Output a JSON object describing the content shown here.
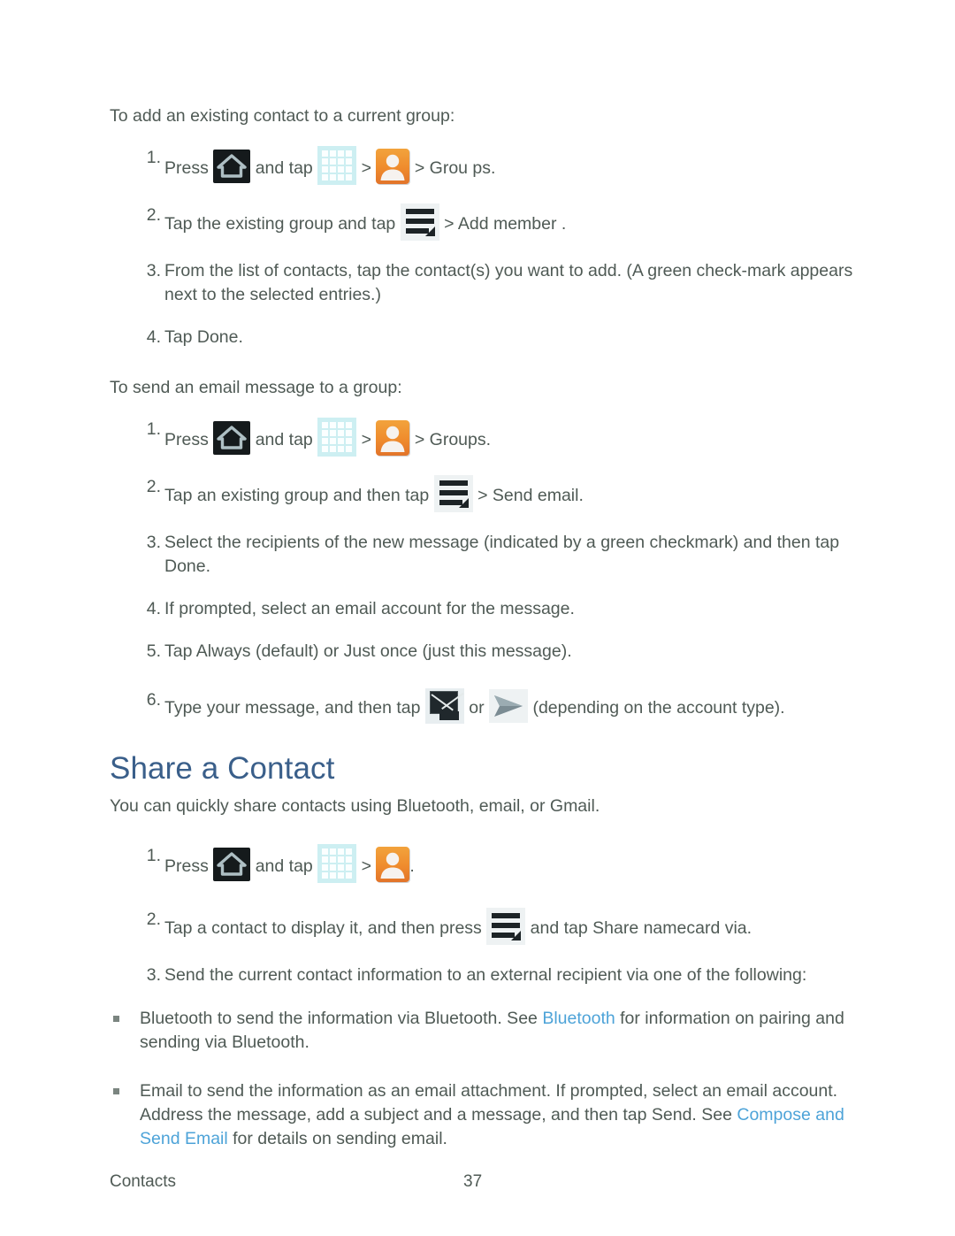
{
  "sections": [
    {
      "intro": "To add an existing contact to a current group:",
      "steps": [
        {
          "num": "1.",
          "pre": "Press",
          "mid": "and tap",
          "sep1": ">",
          "sep2": ">",
          "post": "Grou ps."
        },
        {
          "num": "2.",
          "pre": "Tap the existing group and tap",
          "sep1": ">",
          "post": "Add member ."
        },
        {
          "num": "3.",
          "text": "From the list of contacts, tap the contact(s) you want to add. (A green check-mark appears next to the selected entries.)"
        },
        {
          "num": "4.",
          "text": "Tap Done."
        }
      ]
    },
    {
      "intro": "To send an email message to a group:",
      "steps": [
        {
          "num": "1.",
          "pre": "Press",
          "mid": "and tap",
          "sep1": ">",
          "sep2": ">",
          "post": "Groups."
        },
        {
          "num": "2.",
          "pre": "Tap an existing group and then tap",
          "sep1": ">",
          "post": "Send email."
        },
        {
          "num": "3.",
          "text": "Select the recipients of the new message (indicated by a green checkmark) and then tap Done."
        },
        {
          "num": "4.",
          "text": "If prompted, select an email account for the message."
        },
        {
          "num": "5.",
          "text": "Tap Always  (default) or Just once  (just this message)."
        },
        {
          "num": "6.",
          "pre": "Type your message, and then tap",
          "mid": "or",
          "post": "(depending on the account type)."
        }
      ]
    }
  ],
  "share_section": {
    "title": "Share a Contact",
    "intro": "You can quickly share contacts using Bluetooth, email, or Gmail.",
    "steps": [
      {
        "num": "1.",
        "pre": "Press",
        "mid": "and tap",
        "sep1": ">",
        "post": "."
      },
      {
        "num": "2.",
        "pre": "Tap a contact to display it, and then press",
        "post": "and tap Share namecard via."
      },
      {
        "num": "3.",
        "text": "Send the current contact information to an external recipient via one of the following:"
      }
    ],
    "bullets": [
      {
        "pre": "Bluetooth  to send the information via Bluetooth. See ",
        "link": "Bluetooth",
        "post": " for information on pairing and sending via Bluetooth."
      },
      {
        "pre": "Email to send the information as an email attachment. If prompted, select an email account. Address the message, add a subject and a message, and then tap Send. See ",
        "link": "Compose and Send Email",
        "post": " for details on sending email."
      }
    ]
  },
  "footer": {
    "chapter": "Contacts",
    "page_number": "37"
  },
  "icons": {
    "home": "home-icon",
    "apps": "apps-grid-icon",
    "contacts": "contacts-person-icon",
    "menu": "menu-icon",
    "send_mail": "send-email-icon",
    "send_arrow": "send-arrow-icon"
  },
  "colors": {
    "heading": "#3a5f8a",
    "link": "#4da3d8",
    "body_text": "#4f5a55",
    "contacts_icon_orange": "#ef8b2d",
    "apps_icon_cyan": "#cdeff2"
  }
}
